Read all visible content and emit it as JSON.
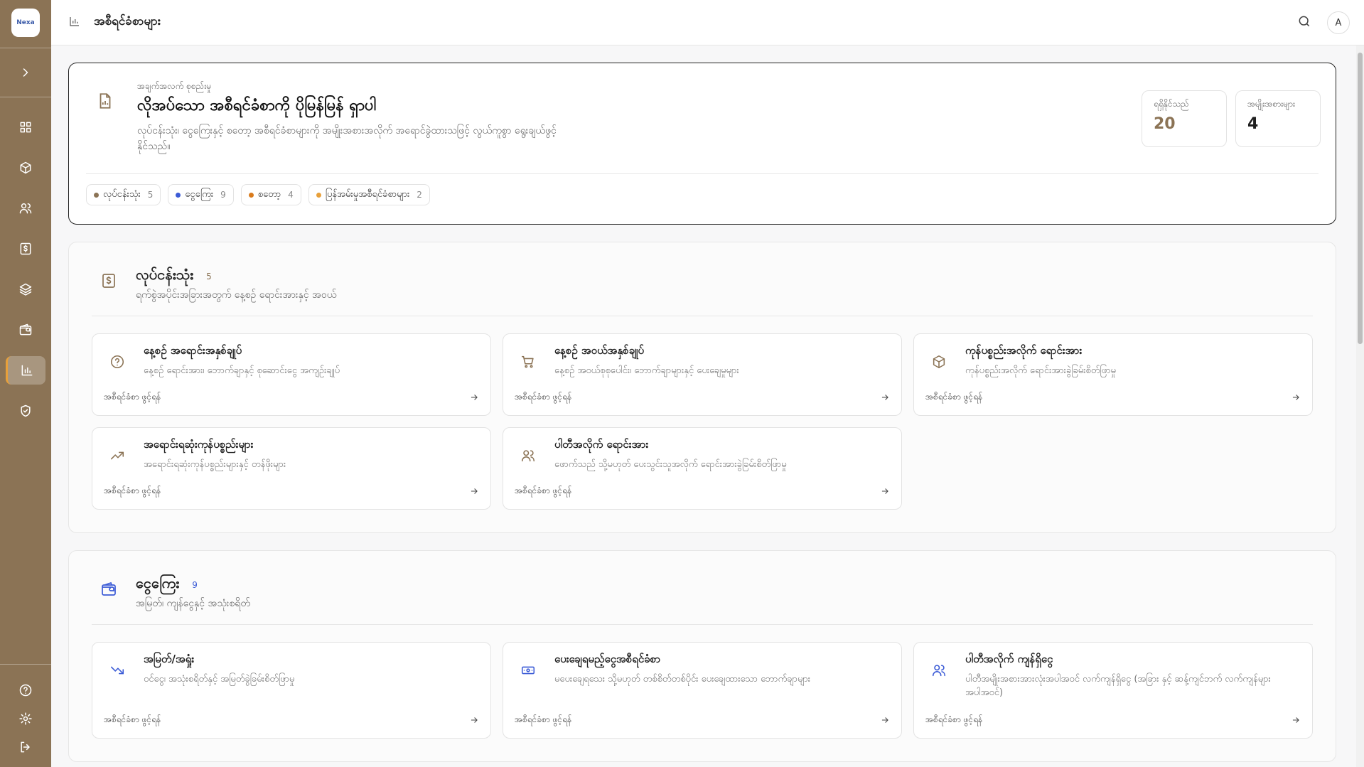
{
  "app": {
    "logo_text": "Nexa"
  },
  "topbar": {
    "title": "အစီရင်ခံစာများ",
    "avatar": "A"
  },
  "hero": {
    "eyebrow": "အချက်အလက် စုစည်းမှု",
    "title": "လိုအပ်သော အစီရင်ခံစာကို ပိုမြန်မြန် ရှာပါ",
    "description": "လုပ်ငန်းသုံး၊ ငွေကြေးနှင့် စတော့ အစီရင်ခံစာများကို အမျိုးအစားအလိုက် အရောင်ခွဲထားသဖြင့် လွယ်ကူစွာ ရွေးချယ်ဖွင့်နိုင်သည်။",
    "stats": [
      {
        "label": "ရရှိနိုင်သည်",
        "value": "20",
        "color": "#8b7355"
      },
      {
        "label": "အမျိုးအစားများ",
        "value": "4",
        "color": "#111111"
      }
    ],
    "chips": [
      {
        "label": "လုပ်ငန်းသုံး",
        "count": "5",
        "color": "#8b7355"
      },
      {
        "label": "ငွေကြေး",
        "count": "9",
        "color": "#3b5bd6"
      },
      {
        "label": "စတော့",
        "count": "4",
        "color": "#d97b1c"
      },
      {
        "label": "ပြန်အမ်းမှုအစီရင်ခံစာများ",
        "count": "2",
        "color": "#e8a03a"
      }
    ]
  },
  "sections": [
    {
      "title": "လုပ်ငန်းသုံး",
      "count": "5",
      "description": "ရက်စွဲအပိုင်းအခြားအတွက် နေ့စဉ် ရောင်းအားနှင့် အဝယ်",
      "color": "#8b7355",
      "cards": [
        {
          "title": "နေ့စဉ် အရောင်းအနှစ်ချုပ်",
          "description": "နေ့စဉ် ရောင်းအား၊ ဘောက်ချာနှင့် စုဆောင်းငွေ အကျဉ်းချုပ်",
          "link": "အစီရင်ခံစာ ဖွင့်ရန်"
        },
        {
          "title": "နေ့စဉ် အဝယ်အနှစ်ချုပ်",
          "description": "နေ့စဉ် အဝယ်စုစုပေါင်း၊ ဘောက်ချာများနှင့် ပေးချေမှုများ",
          "link": "အစီရင်ခံစာ ဖွင့်ရန်"
        },
        {
          "title": "ကုန်ပစ္စည်းအလိုက် ရောင်းအား",
          "description": "ကုန်ပစ္စည်းအလိုက် ရောင်းအားခွဲခြမ်းစိတ်ဖြာမှု",
          "link": "အစီရင်ခံစာ ဖွင့်ရန်"
        },
        {
          "title": "အရောင်းရဆုံးကုန်ပစ္စည်းများ",
          "description": "အရောင်းရဆုံးကုန်ပစ္စည်းများနှင့် တန်ဖိုးများ",
          "link": "အစီရင်ခံစာ ဖွင့်ရန်"
        },
        {
          "title": "ပါတီအလိုက် ရောင်းအား",
          "description": "ဖောက်သည် သို့မဟုတ် ပေးသွင်းသူအလိုက် ရောင်းအားခွဲခြမ်းစိတ်ဖြာမှု",
          "link": "အစီရင်ခံစာ ဖွင့်ရန်"
        }
      ]
    },
    {
      "title": "ငွေကြေး",
      "count": "9",
      "description": "အမြတ်၊ ကျန်ငွေနှင့် အသုံးစရိတ်",
      "color": "#3b5bd6",
      "cards": [
        {
          "title": "အမြတ်/အရှုံး",
          "description": "ဝင်ငွေ၊ အသုံးစရိတ်နှင့် အမြတ်ခွဲခြမ်းစိတ်ဖြာမှု",
          "link": "အစီရင်ခံစာ ဖွင့်ရန်"
        },
        {
          "title": "ပေးချေရမည့်ငွေအစီရင်ခံစာ",
          "description": "မပေးချေရသေး သို့မဟုတ် တစ်စိတ်တစ်ပိုင်း ပေးချေထားသော ဘောက်ချာများ",
          "link": "အစီရင်ခံစာ ဖွင့်ရန်"
        },
        {
          "title": "ပါတီအလိုက် ကျန်ရှိငွေ",
          "description": "ပါတီအမျိုးအစားအားလုံးအပါအဝင် လက်ကျန်ရှိငွေ (အခြား နှင့် ဆန့်ကျင်ဘက် လက်ကျန်များ အပါအဝင်)",
          "link": "အစီရင်ခံစာ ဖွင့်ရန်"
        }
      ]
    }
  ],
  "sidebar": {
    "items": [
      "dashboard-icon",
      "box-icon",
      "users-icon",
      "dollar-icon",
      "layers-icon",
      "wallet-icon",
      "chart-icon",
      "shield-icon"
    ],
    "active": "chart-icon"
  }
}
